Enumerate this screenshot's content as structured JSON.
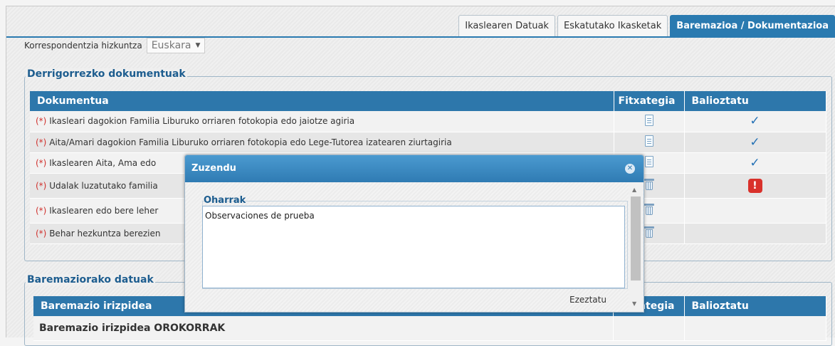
{
  "tabs": [
    "Ikaslearen Datuak",
    "Eskatutako Ikasketak",
    "Baremazioa / Dokumentazioa"
  ],
  "lang": {
    "label": "Korrespondentzia hizkuntza",
    "value": "Euskara"
  },
  "required_docs": {
    "legend": "Derrigorrezko dokumentuak",
    "headers": [
      "Dokumentua",
      "Fitxategia",
      "Balioztatu"
    ],
    "required_marker": "(*)",
    "rows": [
      {
        "text": "Ikasleari dagokion Familia Liburuko orriaren fotokopia edo jaiotze agiria",
        "file": "document-icon",
        "status": "check-icon"
      },
      {
        "text": "Aita/Amari dagokion Familia Liburuko orriaren fotokopia edo Lege-Tutorea izatearen ziurtagiria",
        "file": "document-icon",
        "status": "check-icon"
      },
      {
        "text": "Ikaslearen Aita, Ama edo",
        "file": "document-icon",
        "status": "check-icon"
      },
      {
        "text": "Udalak luzatutako familia",
        "file": "trash-icon",
        "status": "alert-icon",
        "alert": "!"
      },
      {
        "text": "Ikaslearen edo bere leher",
        "file": "trash-icon",
        "status": ""
      },
      {
        "text": "Behar hezkuntza berezien",
        "file": "trash-icon",
        "status": ""
      }
    ],
    "check_glyph": "✓"
  },
  "baremazio": {
    "legend": "Baremaziorako datuak",
    "headers": [
      "Baremazio irizpidea",
      "Fitxategia",
      "Balioztatu"
    ],
    "section": "Baremazio irizpidea OROKORRAK"
  },
  "dialog": {
    "title": "Zuzendu",
    "notes_legend": "Oharrak",
    "notes_value": "Observaciones de prueba",
    "cancel": "Ezeztatu"
  }
}
